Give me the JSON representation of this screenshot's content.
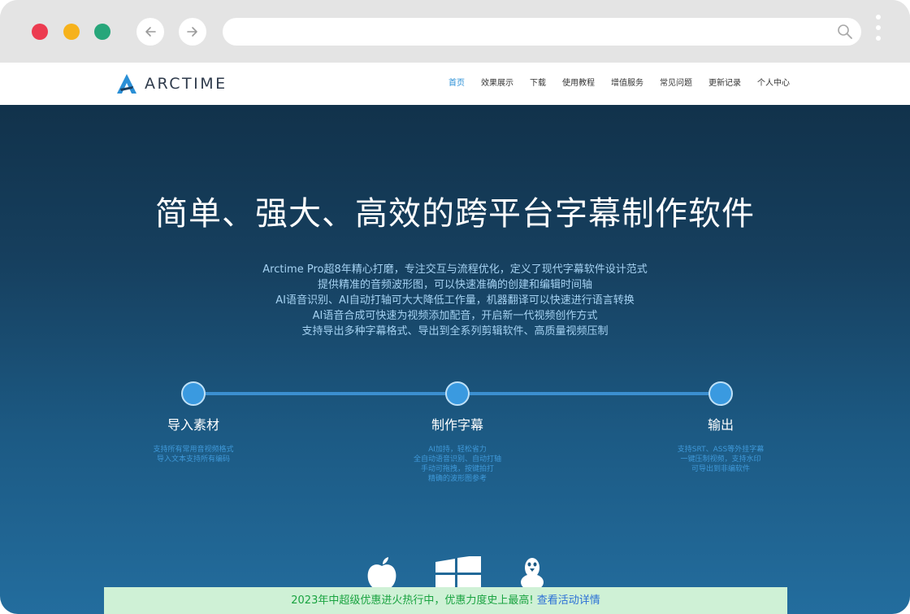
{
  "browser": {
    "back_icon": "arrow-left-icon",
    "forward_icon": "arrow-right-icon",
    "address_value": "",
    "search_icon": "search-icon",
    "menu_icon": "kebab-menu-icon",
    "traffic_lights": [
      "#ec3b50",
      "#f6b21b",
      "#27a67a"
    ]
  },
  "site": {
    "logo_text": "ARCTIME",
    "nav": [
      {
        "label": "首页",
        "active": true
      },
      {
        "label": "效果展示"
      },
      {
        "label": "下载"
      },
      {
        "label": "使用教程"
      },
      {
        "label": "增值服务"
      },
      {
        "label": "常见问题"
      },
      {
        "label": "更新记录"
      },
      {
        "label": "个人中心"
      }
    ],
    "accent": "#2a8fd6"
  },
  "hero": {
    "title": "简单、强大、高效的跨平台字幕制作软件",
    "description": [
      "Arctime Pro超8年精心打磨，专注交互与流程优化，定义了现代字幕软件设计范式",
      "提供精准的音频波形图，可以快速准确的创建和编辑时间轴",
      "AI语音识别、AI自动打轴可大大降低工作量，机器翻译可以快速进行语言转换",
      "AI语音合成可快速为视频添加配音，开启新一代视频创作方式",
      "支持导出多种字幕格式、导出到全系列剪辑软件、高质量视频压制"
    ],
    "steps": [
      {
        "title": "导入素材",
        "desc": [
          "支持所有常用音视频格式",
          "导入文本支持所有编码"
        ]
      },
      {
        "title": "制作字幕",
        "desc": [
          "AI加持，轻松省力",
          "全自动语音识别、自动打轴",
          "手动可拖拽，按键拍打",
          "精确的波形图参考"
        ]
      },
      {
        "title": "输出",
        "desc": [
          "支持SRT、ASS等外挂字幕",
          "一键压制视频，支持水印",
          "可导出到非编软件"
        ]
      }
    ],
    "platform_icons": [
      "apple-icon",
      "windows-icon",
      "linux-icon"
    ]
  },
  "promo": {
    "text": "2023年中超级优惠进火热行中，优惠力度史上最高! ",
    "link": "查看活动详情"
  }
}
